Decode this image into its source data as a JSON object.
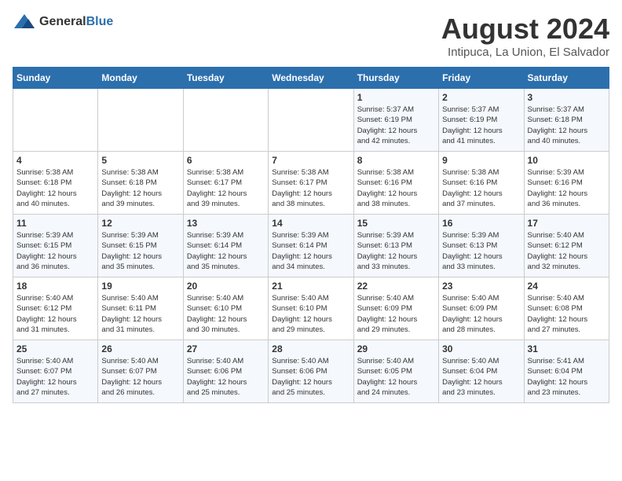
{
  "logo": {
    "general": "General",
    "blue": "Blue"
  },
  "header": {
    "title": "August 2024",
    "subtitle": "Intipuca, La Union, El Salvador"
  },
  "weekdays": [
    "Sunday",
    "Monday",
    "Tuesday",
    "Wednesday",
    "Thursday",
    "Friday",
    "Saturday"
  ],
  "weeks": [
    [
      {
        "day": "",
        "info": ""
      },
      {
        "day": "",
        "info": ""
      },
      {
        "day": "",
        "info": ""
      },
      {
        "day": "",
        "info": ""
      },
      {
        "day": "1",
        "info": "Sunrise: 5:37 AM\nSunset: 6:19 PM\nDaylight: 12 hours\nand 42 minutes."
      },
      {
        "day": "2",
        "info": "Sunrise: 5:37 AM\nSunset: 6:19 PM\nDaylight: 12 hours\nand 41 minutes."
      },
      {
        "day": "3",
        "info": "Sunrise: 5:37 AM\nSunset: 6:18 PM\nDaylight: 12 hours\nand 40 minutes."
      }
    ],
    [
      {
        "day": "4",
        "info": "Sunrise: 5:38 AM\nSunset: 6:18 PM\nDaylight: 12 hours\nand 40 minutes."
      },
      {
        "day": "5",
        "info": "Sunrise: 5:38 AM\nSunset: 6:18 PM\nDaylight: 12 hours\nand 39 minutes."
      },
      {
        "day": "6",
        "info": "Sunrise: 5:38 AM\nSunset: 6:17 PM\nDaylight: 12 hours\nand 39 minutes."
      },
      {
        "day": "7",
        "info": "Sunrise: 5:38 AM\nSunset: 6:17 PM\nDaylight: 12 hours\nand 38 minutes."
      },
      {
        "day": "8",
        "info": "Sunrise: 5:38 AM\nSunset: 6:16 PM\nDaylight: 12 hours\nand 38 minutes."
      },
      {
        "day": "9",
        "info": "Sunrise: 5:38 AM\nSunset: 6:16 PM\nDaylight: 12 hours\nand 37 minutes."
      },
      {
        "day": "10",
        "info": "Sunrise: 5:39 AM\nSunset: 6:16 PM\nDaylight: 12 hours\nand 36 minutes."
      }
    ],
    [
      {
        "day": "11",
        "info": "Sunrise: 5:39 AM\nSunset: 6:15 PM\nDaylight: 12 hours\nand 36 minutes."
      },
      {
        "day": "12",
        "info": "Sunrise: 5:39 AM\nSunset: 6:15 PM\nDaylight: 12 hours\nand 35 minutes."
      },
      {
        "day": "13",
        "info": "Sunrise: 5:39 AM\nSunset: 6:14 PM\nDaylight: 12 hours\nand 35 minutes."
      },
      {
        "day": "14",
        "info": "Sunrise: 5:39 AM\nSunset: 6:14 PM\nDaylight: 12 hours\nand 34 minutes."
      },
      {
        "day": "15",
        "info": "Sunrise: 5:39 AM\nSunset: 6:13 PM\nDaylight: 12 hours\nand 33 minutes."
      },
      {
        "day": "16",
        "info": "Sunrise: 5:39 AM\nSunset: 6:13 PM\nDaylight: 12 hours\nand 33 minutes."
      },
      {
        "day": "17",
        "info": "Sunrise: 5:40 AM\nSunset: 6:12 PM\nDaylight: 12 hours\nand 32 minutes."
      }
    ],
    [
      {
        "day": "18",
        "info": "Sunrise: 5:40 AM\nSunset: 6:12 PM\nDaylight: 12 hours\nand 31 minutes."
      },
      {
        "day": "19",
        "info": "Sunrise: 5:40 AM\nSunset: 6:11 PM\nDaylight: 12 hours\nand 31 minutes."
      },
      {
        "day": "20",
        "info": "Sunrise: 5:40 AM\nSunset: 6:10 PM\nDaylight: 12 hours\nand 30 minutes."
      },
      {
        "day": "21",
        "info": "Sunrise: 5:40 AM\nSunset: 6:10 PM\nDaylight: 12 hours\nand 29 minutes."
      },
      {
        "day": "22",
        "info": "Sunrise: 5:40 AM\nSunset: 6:09 PM\nDaylight: 12 hours\nand 29 minutes."
      },
      {
        "day": "23",
        "info": "Sunrise: 5:40 AM\nSunset: 6:09 PM\nDaylight: 12 hours\nand 28 minutes."
      },
      {
        "day": "24",
        "info": "Sunrise: 5:40 AM\nSunset: 6:08 PM\nDaylight: 12 hours\nand 27 minutes."
      }
    ],
    [
      {
        "day": "25",
        "info": "Sunrise: 5:40 AM\nSunset: 6:07 PM\nDaylight: 12 hours\nand 27 minutes."
      },
      {
        "day": "26",
        "info": "Sunrise: 5:40 AM\nSunset: 6:07 PM\nDaylight: 12 hours\nand 26 minutes."
      },
      {
        "day": "27",
        "info": "Sunrise: 5:40 AM\nSunset: 6:06 PM\nDaylight: 12 hours\nand 25 minutes."
      },
      {
        "day": "28",
        "info": "Sunrise: 5:40 AM\nSunset: 6:06 PM\nDaylight: 12 hours\nand 25 minutes."
      },
      {
        "day": "29",
        "info": "Sunrise: 5:40 AM\nSunset: 6:05 PM\nDaylight: 12 hours\nand 24 minutes."
      },
      {
        "day": "30",
        "info": "Sunrise: 5:40 AM\nSunset: 6:04 PM\nDaylight: 12 hours\nand 23 minutes."
      },
      {
        "day": "31",
        "info": "Sunrise: 5:41 AM\nSunset: 6:04 PM\nDaylight: 12 hours\nand 23 minutes."
      }
    ]
  ]
}
